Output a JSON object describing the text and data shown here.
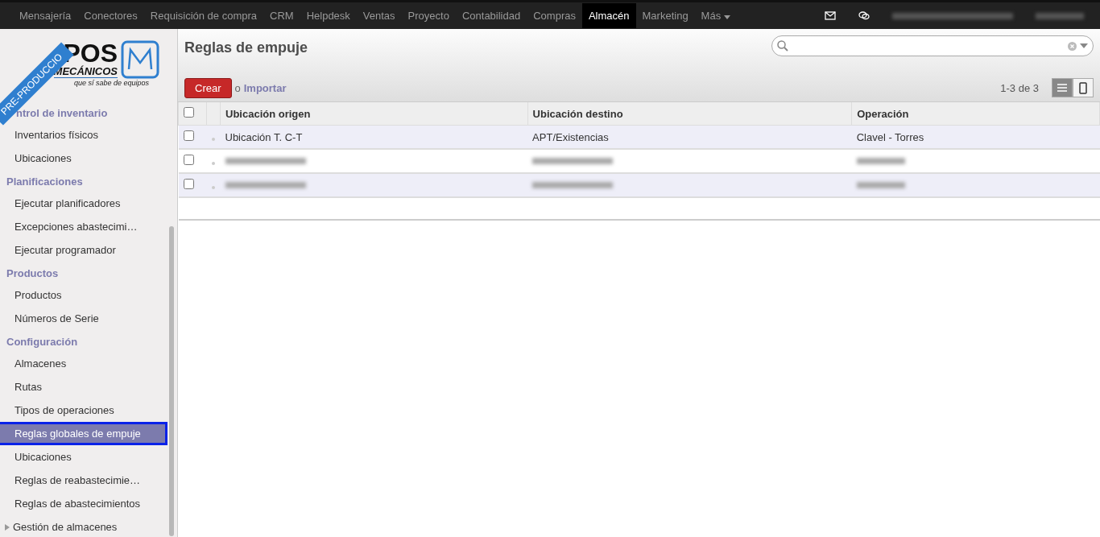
{
  "topbar": {
    "menu": [
      {
        "label": "Mensajería",
        "selected": false
      },
      {
        "label": "Conectores",
        "selected": false
      },
      {
        "label": "Requisición de compra",
        "selected": false
      },
      {
        "label": "CRM",
        "selected": false
      },
      {
        "label": "Helpdesk",
        "selected": false
      },
      {
        "label": "Ventas",
        "selected": false
      },
      {
        "label": "Proyecto",
        "selected": false
      },
      {
        "label": "Contabilidad",
        "selected": false
      },
      {
        "label": "Compras",
        "selected": false
      },
      {
        "label": "Almacén",
        "selected": true
      },
      {
        "label": "Marketing",
        "selected": false
      }
    ],
    "more": "Más"
  },
  "logo": {
    "line_1": "POS",
    "line_2": "MECÁNICOS",
    "tagline": "que sí sabe de equipos",
    "ribbon": "PRE-PRODUCCIO"
  },
  "sidebar": {
    "sections": [
      {
        "title": "ntrol de inventario",
        "items": [
          {
            "label": "Inventarios físicos",
            "selected": false
          },
          {
            "label": "Ubicaciones",
            "selected": false
          }
        ]
      },
      {
        "title": "Planificaciones",
        "items": [
          {
            "label": "Ejecutar planificadores",
            "selected": false
          },
          {
            "label": "Excepciones abastecimi…",
            "selected": false
          },
          {
            "label": "Ejecutar programador",
            "selected": false
          }
        ]
      },
      {
        "title": "Productos",
        "items": [
          {
            "label": "Productos",
            "selected": false
          },
          {
            "label": "Números de Serie",
            "selected": false
          }
        ]
      },
      {
        "title": "Configuración",
        "items": [
          {
            "label": "Almacenes",
            "selected": false
          },
          {
            "label": "Rutas",
            "selected": false
          },
          {
            "label": "Tipos de operaciones",
            "selected": false
          },
          {
            "label": "Reglas globales de empuje",
            "selected": true
          },
          {
            "label": "Ubicaciones",
            "selected": false
          },
          {
            "label": "Reglas de reabastecimie…",
            "selected": false
          },
          {
            "label": "Reglas de abastecimientos",
            "selected": false
          },
          {
            "label": "Gestión de almacenes",
            "selected": false,
            "collapsed": true
          }
        ]
      }
    ]
  },
  "page": {
    "title": "Reglas de empuje",
    "create": "Crear",
    "or": "o",
    "import": "Importar",
    "pager": "1-3 de 3",
    "views": [
      {
        "kind": "list",
        "selected": true
      },
      {
        "kind": "form",
        "selected": false
      }
    ]
  },
  "table": {
    "all_checked": false,
    "columns": [
      "Ubicación origen",
      "Ubicación destino",
      "Operación"
    ],
    "rows": [
      {
        "kind": "text",
        "checked": false,
        "cells": [
          "Ubicación T. C-T",
          "APT/Existencias",
          "Clavel - Torres"
        ]
      },
      {
        "kind": "blurred",
        "checked": false
      },
      {
        "kind": "blurred",
        "checked": false
      }
    ]
  }
}
